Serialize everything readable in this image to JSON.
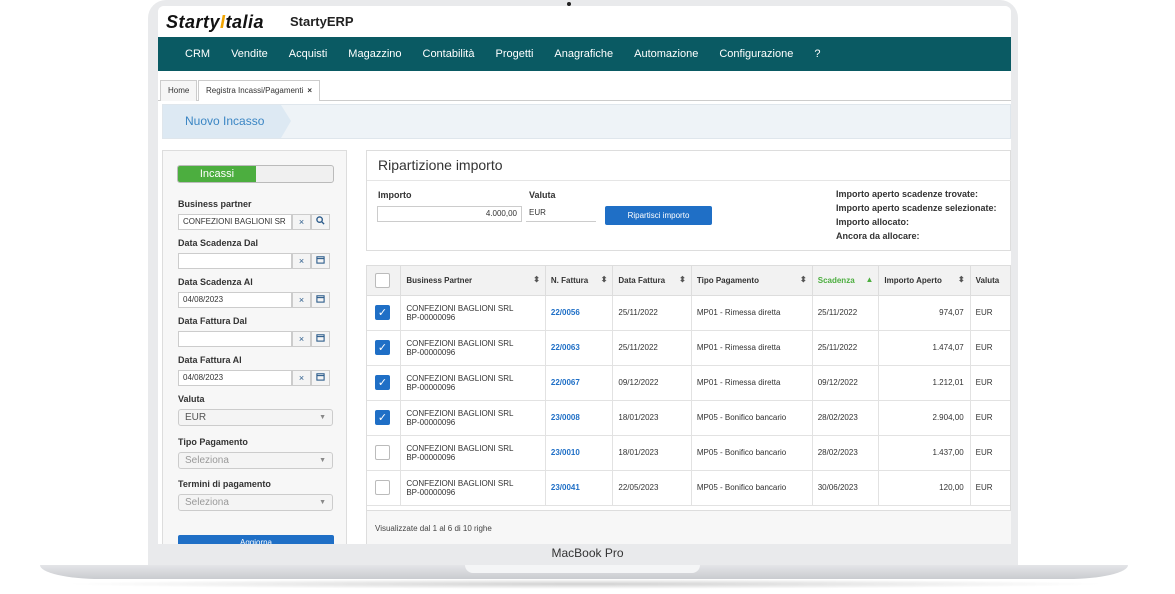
{
  "device": {
    "model": "MacBook Pro"
  },
  "app": {
    "logo_left": "Starty",
    "logo_mid": "I",
    "logo_right": "talia",
    "name": "StartyERP"
  },
  "nav": [
    "CRM",
    "Vendite",
    "Acquisti",
    "Magazzino",
    "Contabilità",
    "Progetti",
    "Anagrafiche",
    "Automazione",
    "Configurazione",
    "?"
  ],
  "tabs": {
    "home": "Home",
    "active": "Registra Incassi/Pagamenti",
    "close": "×"
  },
  "breadcrumb": "Nuovo Incasso",
  "filters": {
    "toggle_on": "Incassi",
    "business_partner_label": "Business partner",
    "business_partner_value": "CONFEZIONI BAGLIONI SR",
    "scad_dal_label": "Data Scadenza Dal",
    "scad_dal_value": "",
    "scad_al_label": "Data Scadenza Al",
    "scad_al_value": "04/08/2023",
    "fatt_dal_label": "Data Fattura Dal",
    "fatt_dal_value": "",
    "fatt_al_label": "Data Fattura Al",
    "fatt_al_value": "04/08/2023",
    "valuta_label": "Valuta",
    "valuta_value": "EUR",
    "tipo_label": "Tipo Pagamento",
    "tipo_value": "Seleziona",
    "termini_label": "Termini di pagamento",
    "termini_value": "Seleziona",
    "clear_icon": "×",
    "update_label": "Aggiorna"
  },
  "ripartizione": {
    "title": "Ripartizione importo",
    "importo_label": "Importo",
    "importo_value": "4.000,00",
    "valuta_label": "Valuta",
    "valuta_value": "EUR",
    "button": "Ripartisci importo",
    "summary": [
      "Importo aperto scadenze trovate:",
      "Importo aperto scadenze selezionate:",
      "Importo allocato:",
      "Ancora da allocare:"
    ]
  },
  "grid": {
    "columns": [
      "Business Partner",
      "N. Fattura",
      "Data Fattura",
      "Tipo Pagamento",
      "Scadenza",
      "Importo Aperto",
      "Valuta"
    ],
    "rows": [
      {
        "checked": true,
        "partner": "CONFEZIONI BAGLIONI SRL",
        "bp": "BP-00000096",
        "fattura": "22/0056",
        "data": "25/11/2022",
        "tipo": "MP01 - Rimessa diretta",
        "scadenza": "25/11/2022",
        "importo": "974,07",
        "valuta": "EUR"
      },
      {
        "checked": true,
        "partner": "CONFEZIONI BAGLIONI SRL",
        "bp": "BP-00000096",
        "fattura": "22/0063",
        "data": "25/11/2022",
        "tipo": "MP01 - Rimessa diretta",
        "scadenza": "25/11/2022",
        "importo": "1.474,07",
        "valuta": "EUR"
      },
      {
        "checked": true,
        "partner": "CONFEZIONI BAGLIONI SRL",
        "bp": "BP-00000096",
        "fattura": "22/0067",
        "data": "09/12/2022",
        "tipo": "MP01 - Rimessa diretta",
        "scadenza": "09/12/2022",
        "importo": "1.212,01",
        "valuta": "EUR"
      },
      {
        "checked": true,
        "partner": "CONFEZIONI BAGLIONI SRL",
        "bp": "BP-00000096",
        "fattura": "23/0008",
        "data": "18/01/2023",
        "tipo": "MP05 - Bonifico bancario",
        "scadenza": "28/02/2023",
        "importo": "2.904,00",
        "valuta": "EUR"
      },
      {
        "checked": false,
        "partner": "CONFEZIONI BAGLIONI SRL",
        "bp": "BP-00000096",
        "fattura": "23/0010",
        "data": "18/01/2023",
        "tipo": "MP05 - Bonifico bancario",
        "scadenza": "28/02/2023",
        "importo": "1.437,00",
        "valuta": "EUR"
      },
      {
        "checked": false,
        "partner": "CONFEZIONI BAGLIONI SRL",
        "bp": "BP-00000096",
        "fattura": "23/0041",
        "data": "22/05/2023",
        "tipo": "MP05 - Bonifico bancario",
        "scadenza": "30/06/2023",
        "importo": "120,00",
        "valuta": "EUR"
      }
    ],
    "footer": "Visualizzate dal 1 al 6 di 10 righe"
  },
  "colors": {
    "nav": "#0a5a63",
    "accent": "#1f6fc6",
    "green": "#4cae3f",
    "logo_bar": "#f0a400"
  }
}
